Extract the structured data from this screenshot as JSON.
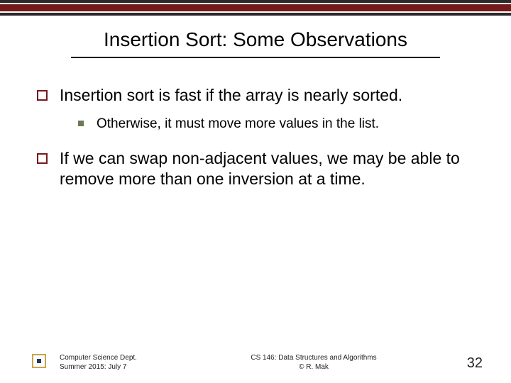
{
  "title": "Insertion Sort: Some Observations",
  "bullets": {
    "b1": "Insertion sort is fast if the array is nearly sorted.",
    "b1_sub1": "Otherwise, it must move more values in the list.",
    "b2": "If we can swap non-adjacent values, we may be able to remove more than one inversion at a time."
  },
  "footer": {
    "left_line1": "Computer Science Dept.",
    "left_line2": "Summer 2015: July 7",
    "center_line1": "CS 146: Data Structures and Algorithms",
    "center_line2": "© R. Mak",
    "page": "32"
  },
  "logo_name": "san-jose-state-university-logo"
}
